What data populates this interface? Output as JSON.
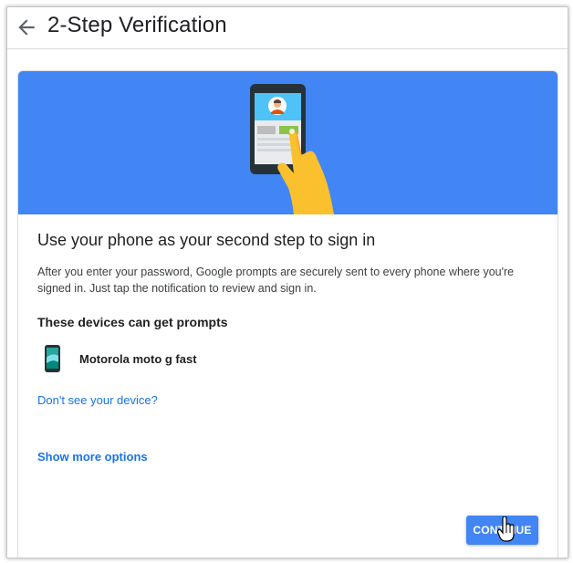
{
  "header": {
    "title": "2-Step Verification",
    "back_icon": "arrow-back-icon"
  },
  "hero": {
    "illustration": "phone-prompt-illustration",
    "background_color": "#4285f4"
  },
  "card": {
    "heading": "Use your phone as your second step to sign in",
    "description": "After you enter your password, Google prompts are securely sent to every phone where you're signed in. Just tap the notification to review and sign in.",
    "devices_heading": "These devices can get prompts",
    "devices": [
      {
        "name": "Motorola moto g fast",
        "icon": "smartphone-icon"
      }
    ],
    "device_help_link": "Don't see your device?",
    "more_options_link": "Show more options",
    "continue_label": "CONTINUE"
  },
  "colors": {
    "accent": "#1a73e8",
    "button": "#4285f4"
  },
  "cursor": "hand-pointer-icon"
}
